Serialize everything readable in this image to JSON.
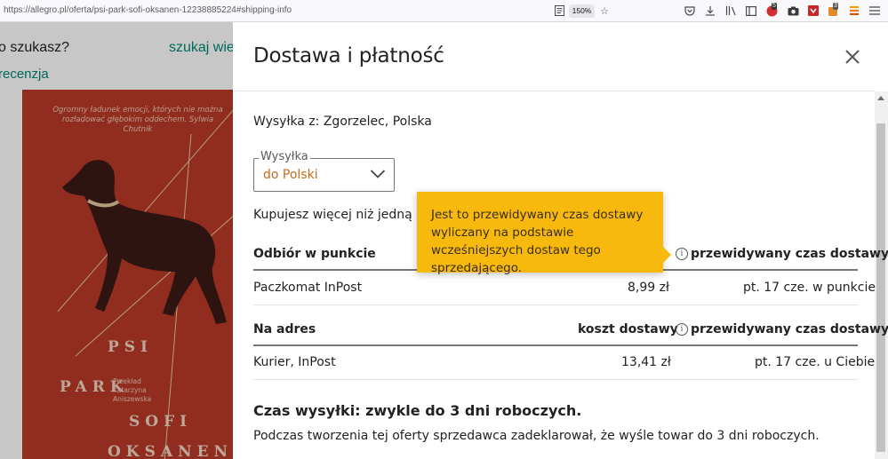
{
  "browser": {
    "url": "https://allegro.pl/oferta/psi-park-sofi-oksanen-12238885224#shipping-info",
    "zoom": "150%",
    "ext_badge_1": "5",
    "ext_badge_2": "3"
  },
  "background_page": {
    "search_text": "o szukasz?",
    "search_link": "szukaj wielu",
    "review_link": "recenzja",
    "book": {
      "quote": "Ogromny ładunek emocji, których nie można rozładować głębokim oddechem. Sylwia Chutnik",
      "title_words": [
        "PSI",
        "PARK",
        "SOFI",
        "OKSANEN"
      ],
      "translator": "Przekład Katarzyna Aniszewska"
    }
  },
  "modal": {
    "title": "Dostawa i płatność",
    "shipping_from": "Wysyłka z: Zgorzelec, Polska",
    "select": {
      "legend": "Wysyłka",
      "value": "do Polski"
    },
    "multi_buy_text": "Kupujesz więcej niż jedną sztu",
    "pickup": {
      "header": "Odbiór w punkcie",
      "time_header": "przewidywany czas dostawy",
      "rows": [
        {
          "name": "Paczkomat InPost",
          "price": "8,99 zł",
          "time": "pt. 17 cze. w punkcie"
        }
      ]
    },
    "address": {
      "header": "Na adres",
      "cost_header": "koszt dostawy",
      "time_header": "przewidywany czas dostawy",
      "rows": [
        {
          "name": "Kurier, InPost",
          "price": "13,41 zł",
          "time": "pt. 17 cze. u Ciebie"
        }
      ]
    },
    "dispatch": {
      "title": "Czas wysyłki: zwykle do 3 dni roboczych.",
      "text": "Podczas tworzenia tej oferty sprzedawca zadeklarował, że wyśle towar do 3 dni roboczych."
    },
    "tooltip": "Jest to przewidywany czas dostawy wyliczany na podstawie wcześniejszych dostaw tego sprzedającego."
  },
  "colors": {
    "accent_orange": "#c96a1a",
    "tooltip_yellow": "#f7b90e",
    "link_teal": "#008673",
    "book_red": "#b93a27"
  }
}
